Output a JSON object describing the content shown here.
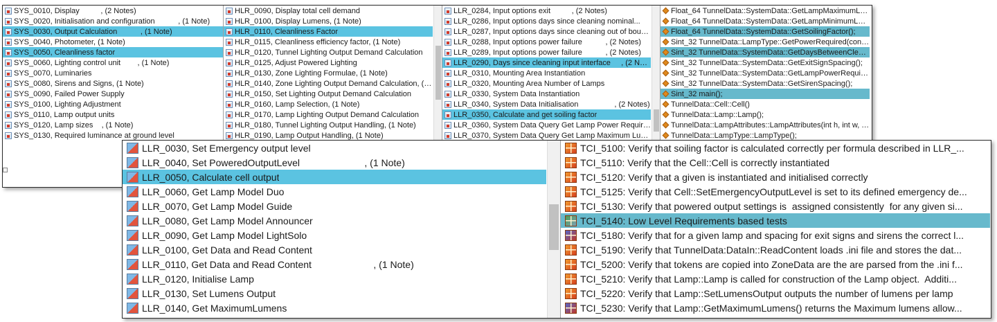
{
  "top_panel": {
    "sys_column": [
      {
        "text": "SYS_0010, Display          , (2 Notes)",
        "icon": "requirement-doc-icon",
        "selected": false
      },
      {
        "text": "SYS_0020, Initialisation and configuration           , (1 Note)",
        "icon": "requirement-doc-icon",
        "selected": false
      },
      {
        "text": "SYS_0030, Output Calculation           , (1 Note)",
        "icon": "requirement-doc-icon",
        "selected": true
      },
      {
        "text": "SYS_0040, Photometer, (1 Note)",
        "icon": "requirement-doc-icon",
        "selected": false
      },
      {
        "text": "SYS_0050, Cleanliness factor",
        "icon": "requirement-doc-icon",
        "selected": true
      },
      {
        "text": "SYS_0060, Lighting control unit        , (1 Note)",
        "icon": "requirement-doc-icon",
        "selected": false
      },
      {
        "text": "SYS_0070, Luminaries",
        "icon": "requirement-doc-icon",
        "selected": false
      },
      {
        "text": "SYS_0080, Sirens and Signs, (1 Note)",
        "icon": "requirement-doc-icon",
        "selected": false
      },
      {
        "text": "SYS_0090, Failed Power Supply",
        "icon": "requirement-doc-icon",
        "selected": false
      },
      {
        "text": "SYS_0100, Lighting Adjustment",
        "icon": "requirement-doc-icon",
        "selected": false
      },
      {
        "text": "SYS_0110, Lamp output units",
        "icon": "requirement-doc-icon",
        "selected": false
      },
      {
        "text": "SYS_0120, Lamp sizes    , (1 Note)",
        "icon": "requirement-doc-icon",
        "selected": false
      },
      {
        "text": "SYS_0130, Required luminance at ground level",
        "icon": "requirement-doc-icon",
        "selected": false
      }
    ],
    "hlr_column": [
      {
        "text": "HLR_0090, Display total cell demand",
        "icon": "requirement-doc-icon",
        "selected": false
      },
      {
        "text": "HLR_0100, Display Lumens, (1 Note)",
        "icon": "requirement-doc-icon",
        "selected": false
      },
      {
        "text": "HLR_0110, Cleanliness Factor",
        "icon": "requirement-doc-icon",
        "selected": true
      },
      {
        "text": "HLR_0115, Cleanliness efficiency factor, (1 Note)",
        "icon": "requirement-doc-icon",
        "selected": false
      },
      {
        "text": "HLR_0120, Tunnel Lighting Output Demand Calculation",
        "icon": "requirement-doc-icon",
        "selected": false
      },
      {
        "text": "HLR_0125, Adjust Powered Lighting",
        "icon": "requirement-doc-icon",
        "selected": false
      },
      {
        "text": "HLR_0130, Zone Lighting Formulae, (1 Note)",
        "icon": "requirement-doc-icon",
        "selected": false
      },
      {
        "text": "HLR_0140, Zone Lighting Output Demand Calculation, (1 N...",
        "icon": "requirement-doc-icon",
        "selected": false
      },
      {
        "text": "HLR_0150, Set Lighting Output Demand Calculation",
        "icon": "requirement-doc-icon",
        "selected": false
      },
      {
        "text": "HLR_0160, Lamp Selection, (1 Note)",
        "icon": "requirement-doc-icon",
        "selected": false
      },
      {
        "text": "HLR_0170, Lamp Lighting Output Demand Calculation",
        "icon": "requirement-doc-icon",
        "selected": false
      },
      {
        "text": "HLR_0180, Tunnel Lighting Output Handling, (1 Note)",
        "icon": "requirement-doc-icon",
        "selected": false
      },
      {
        "text": "HLR_0190, Lamp Output Handling, (1 Note)",
        "icon": "requirement-doc-icon",
        "selected": false
      }
    ],
    "llr_column": [
      {
        "text": "LLR_0284, Input options exit          , (2 Notes)",
        "icon": "requirement-doc-icon",
        "selected": false
      },
      {
        "text": "LLR_0286, Input options days since cleaning nominal...",
        "icon": "requirement-doc-icon",
        "selected": false
      },
      {
        "text": "LLR_0287, Input options days since cleaning out of bounds...",
        "icon": "requirement-doc-icon",
        "selected": false
      },
      {
        "text": "LLR_0288, Input options power failure           , (2 Notes)",
        "icon": "requirement-doc-icon",
        "selected": false
      },
      {
        "text": "LLR_0289, Input options power failure           , (2 Notes)",
        "icon": "requirement-doc-icon",
        "selected": false
      },
      {
        "text": "LLR_0290, Days since cleaning input interface     , (2 Notes)",
        "icon": "requirement-doc-icon",
        "selected": true
      },
      {
        "text": "LLR_0310, Mounting Area Instantiation",
        "icon": "requirement-doc-icon",
        "selected": false
      },
      {
        "text": "LLR_0320, Mounting Area Number of Lamps",
        "icon": "requirement-doc-icon",
        "selected": false
      },
      {
        "text": "LLR_0330, System Data Instantiation",
        "icon": "requirement-doc-icon",
        "selected": false
      },
      {
        "text": "LLR_0340, System Data Initialisation                 , (2 Notes)",
        "icon": "requirement-doc-icon",
        "selected": false
      },
      {
        "text": "LLR_0350, Calculate and get soiling factor",
        "icon": "requirement-doc-icon",
        "selected": true
      },
      {
        "text": "LLR_0360, System Data Query Get Lamp Power Required",
        "icon": "requirement-doc-icon",
        "selected": false
      },
      {
        "text": "LLR_0370, System Data Query Get Lamp Maximum Lumens",
        "icon": "requirement-doc-icon",
        "selected": false
      }
    ],
    "code_column": [
      {
        "text": "Float_64 TunnelData::SystemData::GetLampMaximumLumens...",
        "icon": "code-function-icon",
        "selected": false
      },
      {
        "text": "Float_64 TunnelData::SystemData::GetLampMinimumLumen...",
        "icon": "code-function-icon",
        "selected": false
      },
      {
        "text": "Float_64 TunnelData::SystemData::GetSoilingFactor();",
        "icon": "code-function-icon",
        "selected": true
      },
      {
        "text": "Sint_32 TunnelData::LampType::GetPowerRequired(const Flo...",
        "icon": "code-function-icon",
        "selected": false
      },
      {
        "text": "Sint_32 TunnelData::SystemData::GetDaysBetweenCleaning();",
        "icon": "code-function-icon",
        "selected": true
      },
      {
        "text": "Sint_32 TunnelData::SystemData::GetExitSignSpacing();",
        "icon": "code-function-icon",
        "selected": false
      },
      {
        "text": "Sint_32 TunnelData::SystemData::GetLampPowerRequired(co...",
        "icon": "code-function-icon",
        "selected": false
      },
      {
        "text": "Sint_32 TunnelData::SystemData::GetSirenSpacing();",
        "icon": "code-function-icon",
        "selected": false
      },
      {
        "text": "Sint_32 main();",
        "icon": "code-function-icon",
        "selected": true
      },
      {
        "text": "TunnelData::Cell::Cell()",
        "icon": "code-function-icon",
        "selected": false
      },
      {
        "text": "TunnelData::Lamp::Lamp();",
        "icon": "code-function-icon",
        "selected": false
      },
      {
        "text": "TunnelData::LampAttributes::LampAttributes(int h, int w, Tun...",
        "icon": "code-function-icon",
        "selected": false
      },
      {
        "text": "TunnelData::LampType::LampType();",
        "icon": "code-function-icon",
        "selected": false
      }
    ]
  },
  "bottom_panel": {
    "llr_column": [
      {
        "text": "LLR_0030, Set Emergency output level",
        "icon": "low-level-requirement-icon",
        "selected": false
      },
      {
        "text": "LLR_0040, Set PoweredOutputLevel                        , (1 Note)",
        "icon": "low-level-requirement-icon",
        "selected": false
      },
      {
        "text": "LLR_0050, Calculate cell output",
        "icon": "low-level-requirement-icon",
        "selected": true
      },
      {
        "text": "LLR_0060, Get Lamp Model Duo",
        "icon": "low-level-requirement-icon",
        "selected": false
      },
      {
        "text": "LLR_0070, Get Lamp Model Guide",
        "icon": "low-level-requirement-icon",
        "selected": false
      },
      {
        "text": "LLR_0080, Get Lamp Model Announcer",
        "icon": "low-level-requirement-icon",
        "selected": false
      },
      {
        "text": "LLR_0090, Get Lamp Model LightSolo",
        "icon": "low-level-requirement-icon",
        "selected": false
      },
      {
        "text": "LLR_0100, Get Data and Read Content",
        "icon": "low-level-requirement-icon",
        "selected": false
      },
      {
        "text": "LLR_0110, Get Data and Read Content                       , (1 Note)",
        "icon": "low-level-requirement-icon",
        "selected": false
      },
      {
        "text": "LLR_0120, Initialise Lamp",
        "icon": "low-level-requirement-icon",
        "selected": false
      },
      {
        "text": "LLR_0130, Set Lumens Output",
        "icon": "low-level-requirement-icon",
        "selected": false
      },
      {
        "text": "LLR_0140, Get MaximumLumens",
        "icon": "low-level-requirement-icon",
        "selected": false
      }
    ],
    "tci_column": [
      {
        "text": "TCI_5100: Verify that soiling factor is calculated correctly per formula described in LLR_...",
        "icon": "test-case-icon",
        "variant": "orange",
        "selected": false
      },
      {
        "text": "TCI_5110: Verify that the Cell::Cell is correctly instantiated",
        "icon": "test-case-icon",
        "variant": "orange",
        "selected": false
      },
      {
        "text": "TCI_5120: Verify that a given is instantiated and initialised correctly",
        "icon": "test-case-icon",
        "variant": "orange",
        "selected": false
      },
      {
        "text": "TCI_5125: Verify that Cell::SetEmergencyOutputLevel is set to its defined emergency de...",
        "icon": "test-case-icon",
        "variant": "orange",
        "selected": false
      },
      {
        "text": "TCI_5130: Verify that powered output settings is  assigned consistently  for any given si...",
        "icon": "test-case-icon",
        "variant": "orange",
        "selected": false
      },
      {
        "text": "TCI_5140: Low Level Requirements based tests",
        "icon": "test-case-icon",
        "variant": "green",
        "selected": true
      },
      {
        "text": "TCI_5180: Verify that for a given lamp and spacing for exit signs and sirens the correct l...",
        "icon": "test-case-icon",
        "variant": "blue",
        "selected": false
      },
      {
        "text": "TCI_5190: Verify that TunnelData:DataIn::ReadContent loads .ini file and stores the dat...",
        "icon": "test-case-icon",
        "variant": "orange",
        "selected": false
      },
      {
        "text": "TCI_5200: Verify that tokens are copied into ZoneData are the are parsed from the .ini f...",
        "icon": "test-case-icon",
        "variant": "orange",
        "selected": false
      },
      {
        "text": "TCI_5210: Verify that Lamp::Lamp is called for construction of the Lamp object.  Additi...",
        "icon": "test-case-icon",
        "variant": "orange",
        "selected": false
      },
      {
        "text": "TCI_5220: Verify that Lamp::SetLumensOutput outputs the number of lumens per lamp",
        "icon": "test-case-icon",
        "variant": "orange",
        "selected": false
      },
      {
        "text": "TCI_5230: Verify that Lamp::GetMaximumLumens() returns the Maximum lumens allow...",
        "icon": "test-case-icon",
        "variant": "blue",
        "selected": false
      }
    ]
  },
  "colors": {
    "selection": "#5bc3e1",
    "selection_dark": "#67b9cc",
    "border": "#2b2b2b"
  }
}
